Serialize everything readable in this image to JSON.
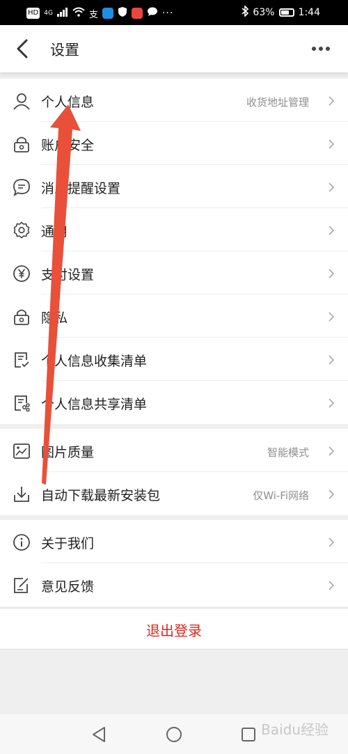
{
  "status_bar": {
    "hd": "HD",
    "signal": "4G",
    "battery_text": "63%",
    "time": "1:44",
    "battery_level": 0.63
  },
  "header": {
    "title": "设置"
  },
  "sections": [
    {
      "items": [
        {
          "label": "个人信息",
          "value": "收货地址管理",
          "icon": "user-icon"
        },
        {
          "label": "账户安全",
          "value": "",
          "icon": "lock-icon"
        },
        {
          "label": "消息提醒设置",
          "value": "",
          "icon": "chat-icon"
        },
        {
          "label": "通用",
          "value": "",
          "icon": "gear-icon"
        },
        {
          "label": "支付设置",
          "value": "",
          "icon": "yen-icon"
        },
        {
          "label": "隐私",
          "value": "",
          "icon": "lock-icon"
        },
        {
          "label": "个人信息收集清单",
          "value": "",
          "icon": "checklist-icon"
        },
        {
          "label": "个人信息共享清单",
          "value": "",
          "icon": "share-list-icon"
        }
      ]
    },
    {
      "items": [
        {
          "label": "图片质量",
          "value": "智能模式",
          "icon": "image-icon"
        },
        {
          "label": "自动下载最新安装包",
          "value": "仅Wi-Fi网络",
          "icon": "download-icon"
        }
      ]
    },
    {
      "items": [
        {
          "label": "关于我们",
          "value": "",
          "icon": "info-icon"
        },
        {
          "label": "意见反馈",
          "value": "",
          "icon": "feedback-icon"
        }
      ]
    }
  ],
  "logout_label": "退出登录",
  "watermark": "Baidu经验",
  "colors": {
    "accent_red": "#e1251b",
    "annotation_arrow": "#e8503a"
  }
}
